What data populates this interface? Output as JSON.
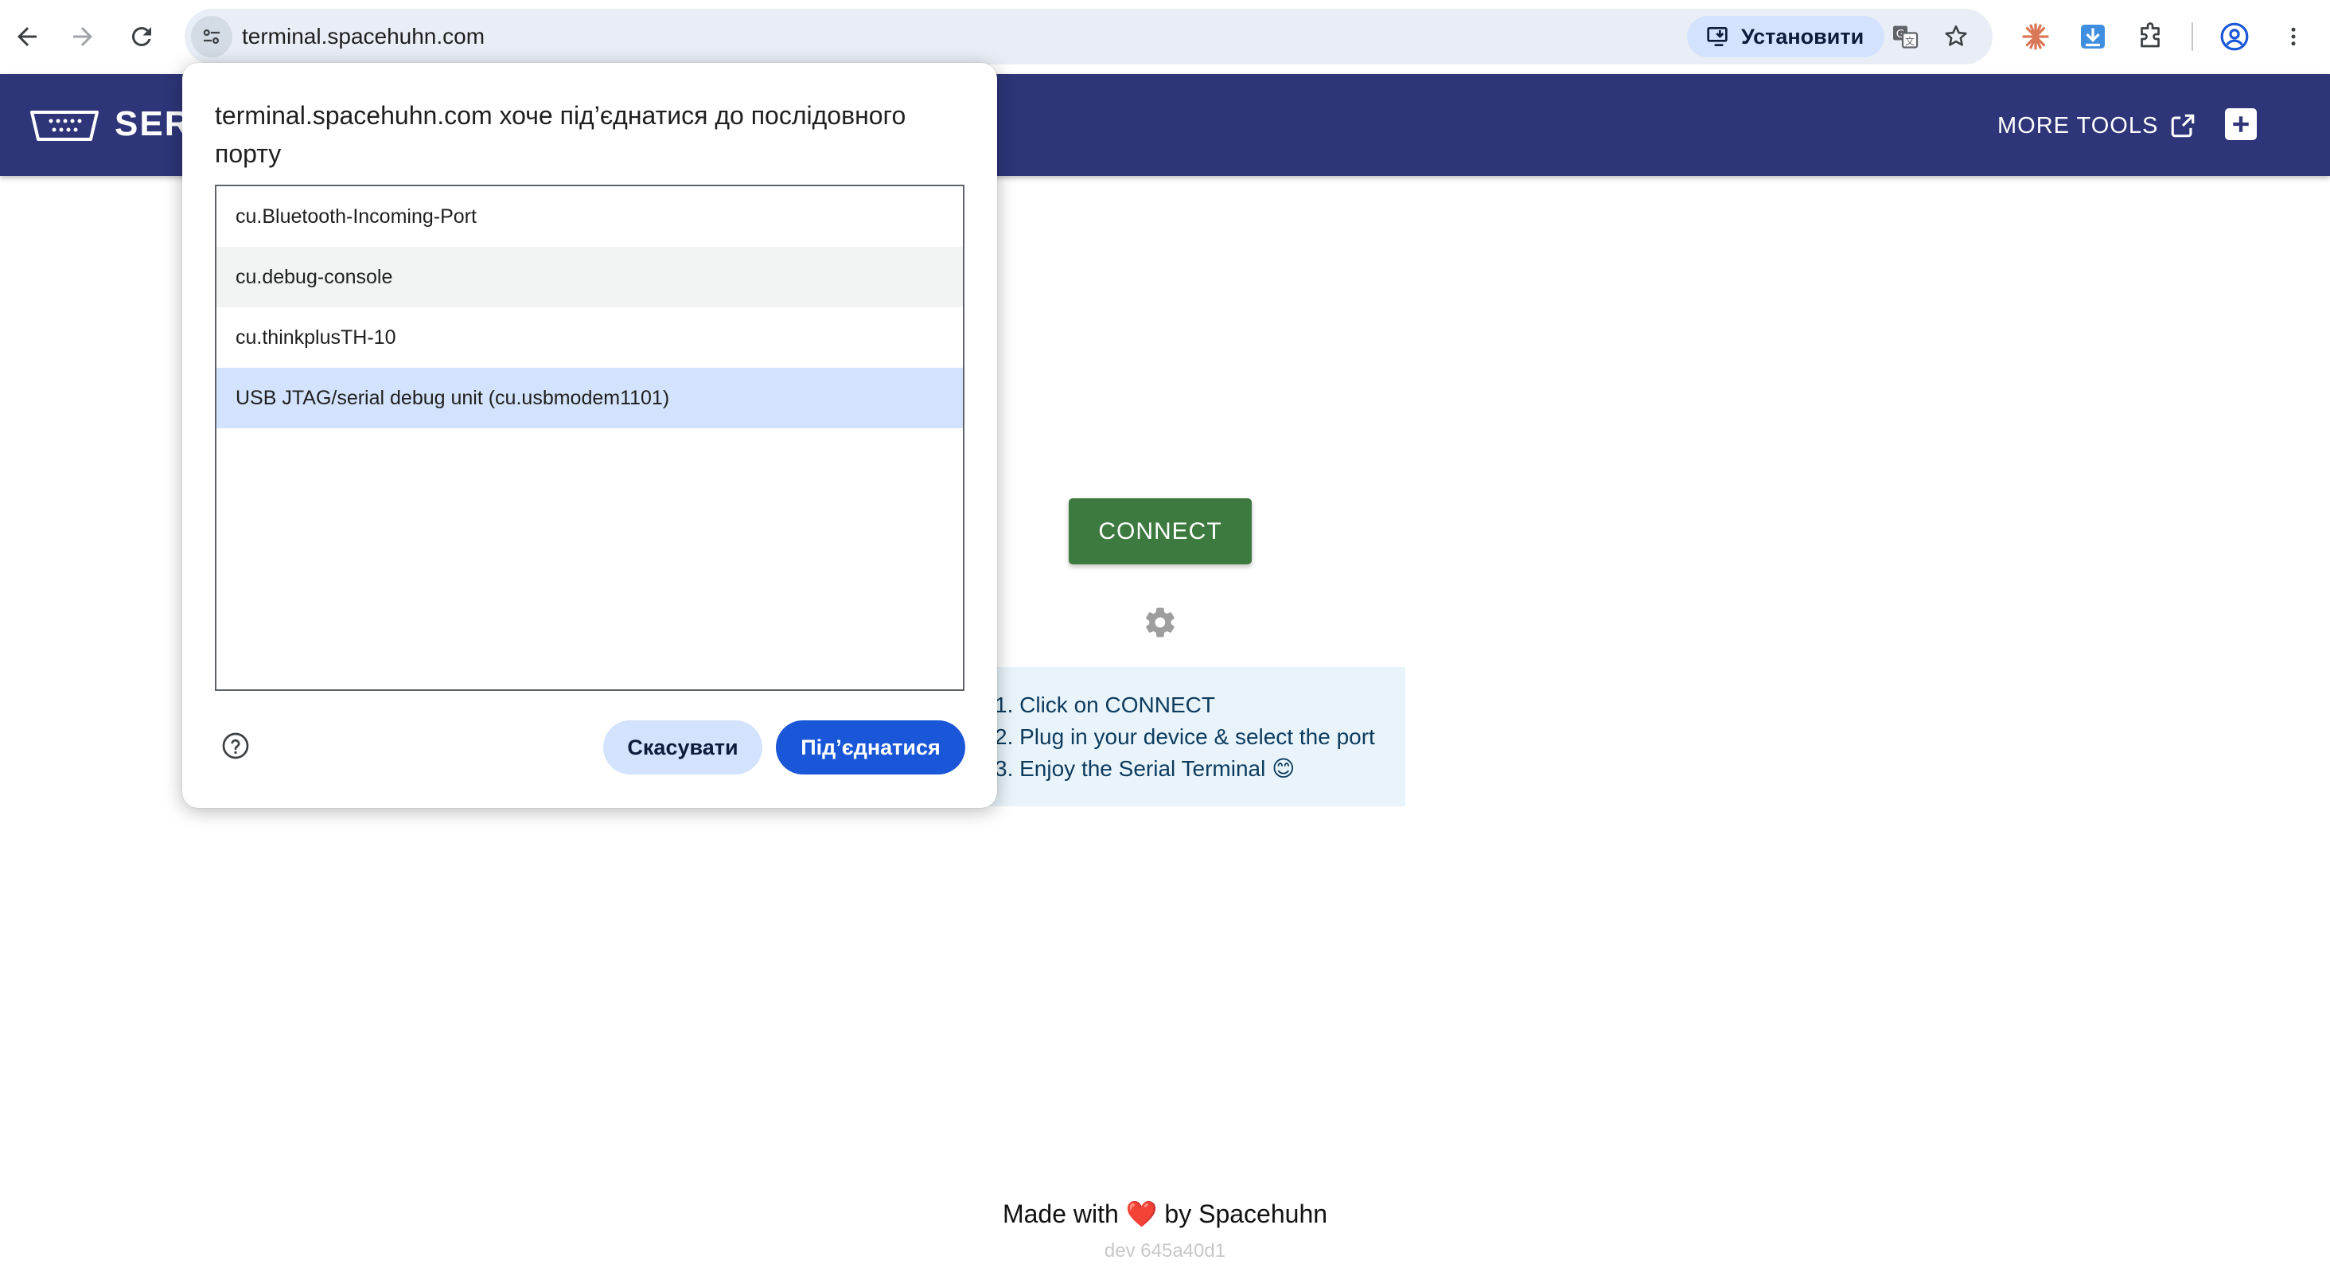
{
  "browser": {
    "url": "terminal.spacehuhn.com",
    "install_label": "Установити"
  },
  "app": {
    "title": "SER",
    "more_tools_label": "MORE TOOLS"
  },
  "main": {
    "connect_label": "CONNECT",
    "instructions": [
      "1. Click on CONNECT",
      "2. Plug in your device & select the port",
      "3. Enjoy the Serial Terminal 😊"
    ],
    "footer_prefix": "Made with",
    "footer_heart": "❤️",
    "footer_suffix": "by Spacehuhn",
    "version": "dev 645a40d1"
  },
  "dialog": {
    "title": "terminal.spacehuhn.com хоче під’єднатися до послідовного порту",
    "ports": [
      "cu.Bluetooth-Incoming-Port",
      "cu.debug-console",
      "cu.thinkplusTH-10",
      "USB JTAG/serial debug unit (cu.usbmodem1101)"
    ],
    "selected_port_index": 3,
    "cancel_label": "Скасувати",
    "connect_label": "Під’єднатися"
  },
  "colors": {
    "header_bg": "#2e3578",
    "connect_btn": "#3d7a3f",
    "dialog_primary": "#1a57d8",
    "selected_row": "#d3e3fd"
  }
}
